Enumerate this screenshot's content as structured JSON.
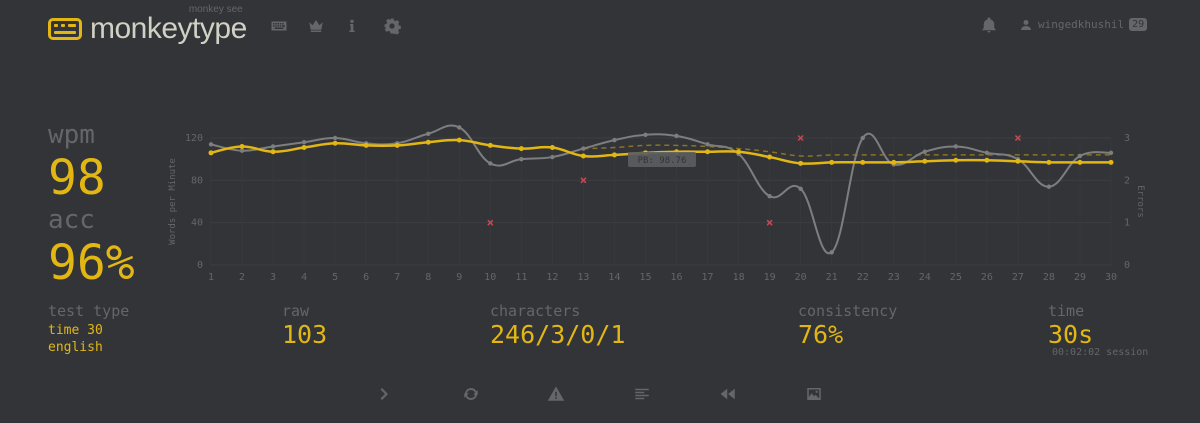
{
  "header": {
    "subtitle": "monkey see",
    "title": "monkeytype",
    "username": "wingedkhushil",
    "level": "29"
  },
  "stats": {
    "wpm_label": "wpm",
    "wpm": "98",
    "acc_label": "acc",
    "acc": "96%",
    "test_type_label": "test type",
    "test_type_mode": "time 30",
    "test_type_language": "english",
    "raw_label": "raw",
    "raw": "103",
    "characters_label": "characters",
    "characters": "246/3/0/1",
    "consistency_label": "consistency",
    "consistency": "76%",
    "time_label": "time",
    "time": "30s",
    "session": "00:02:02 session"
  },
  "colors": {
    "bg": "#323437",
    "main": "#e2b714",
    "sub": "#646669",
    "text": "#d1d0c5",
    "error": "#ca4754"
  },
  "chart_data": {
    "type": "line",
    "x": [
      1,
      2,
      3,
      4,
      5,
      6,
      7,
      8,
      9,
      10,
      11,
      12,
      13,
      14,
      15,
      16,
      17,
      18,
      19,
      20,
      21,
      22,
      23,
      24,
      25,
      26,
      27,
      28,
      29,
      30
    ],
    "ylabel": "Words per Minute",
    "y2label": "Errors",
    "ylim": [
      0,
      120
    ],
    "y2lim": [
      0,
      3
    ],
    "yticks": [
      "0",
      "40",
      "80",
      "120"
    ],
    "y2ticks": [
      "0",
      "1",
      "2",
      "3"
    ],
    "pb_label": "PB: 98.76",
    "series": [
      {
        "values": [
          106,
          112,
          107,
          111,
          115,
          113,
          113,
          116,
          118,
          113,
          110,
          111,
          103,
          104,
          106,
          107,
          107,
          107,
          102,
          96,
          97,
          97,
          97,
          98,
          99,
          99,
          98,
          97,
          97,
          97
        ]
      },
      {
        "values": [
          114,
          108,
          112,
          116,
          120,
          115,
          115,
          124,
          130,
          96,
          100,
          102,
          110,
          118,
          123,
          122,
          114,
          105,
          65,
          72,
          12,
          120,
          95,
          107,
          112,
          106,
          100,
          74,
          103,
          106
        ]
      },
      {
        "values": [
          null,
          null,
          null,
          null,
          null,
          null,
          null,
          null,
          null,
          null,
          null,
          null,
          110,
          111,
          113,
          113,
          112,
          110,
          107,
          103,
          104,
          104,
          104,
          104,
          104,
          104,
          104,
          104,
          104,
          104
        ]
      }
    ],
    "errors": [
      {
        "x": 10,
        "y": 1
      },
      {
        "x": 13,
        "y": 2
      },
      {
        "x": 19,
        "y": 1
      },
      {
        "x": 20,
        "y": 3
      },
      {
        "x": 27,
        "y": 3
      }
    ]
  },
  "icons": [
    "keyboard-icon",
    "crown-icon",
    "info-icon",
    "gear-icon",
    "bell-icon",
    "user-icon",
    "chevron-right-icon",
    "refresh-icon",
    "warning-icon",
    "list-icon",
    "rewind-icon",
    "image-icon"
  ]
}
